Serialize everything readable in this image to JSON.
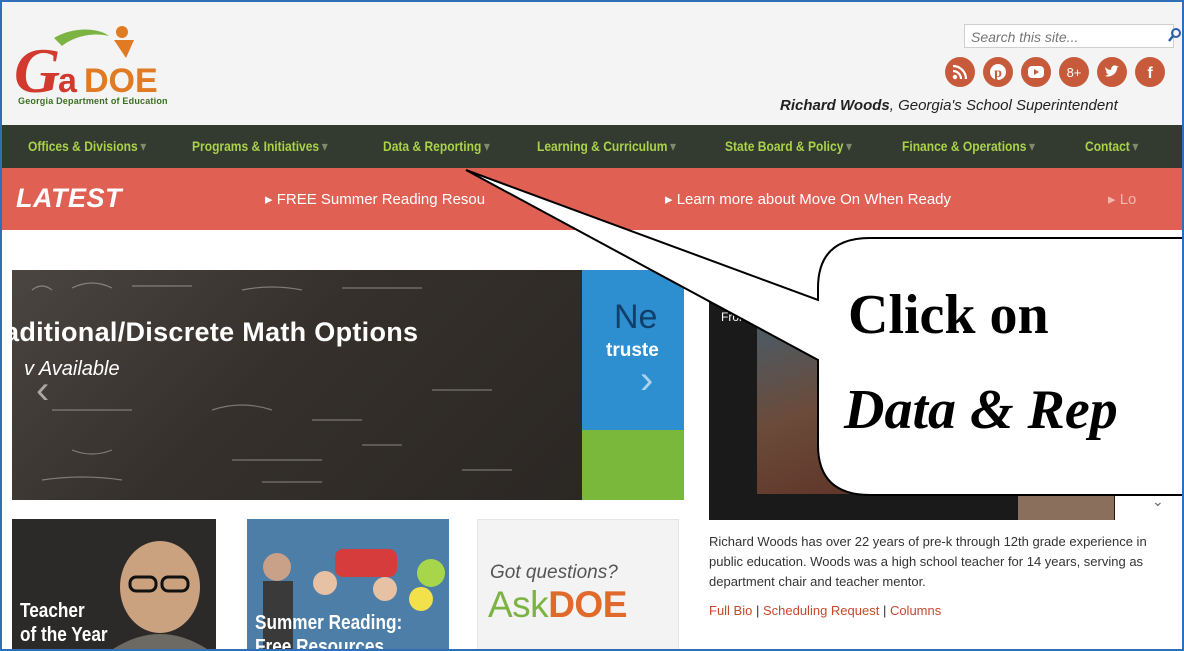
{
  "header": {
    "logo_text": "GaDOE",
    "logo_subtitle": "Georgia Department of Education",
    "search_placeholder": "Search this site...",
    "social_icons": [
      "rss-icon",
      "pinterest-icon",
      "youtube-icon",
      "google-plus-icon",
      "twitter-icon",
      "facebook-icon"
    ],
    "superintendent_name": "Richard Woods",
    "superintendent_title": ", Georgia's School Superintendent"
  },
  "nav": {
    "items": [
      {
        "label": "Offices & Divisions"
      },
      {
        "label": "Programs & Initiatives"
      },
      {
        "label": "Data & Reporting"
      },
      {
        "label": "Learning & Curriculum"
      },
      {
        "label": "State Board & Policy"
      },
      {
        "label": "Finance & Operations"
      },
      {
        "label": "Contact"
      }
    ]
  },
  "latest": {
    "label": "LATEST",
    "items": [
      "▸ FREE Summer Reading Resou",
      "▸ Learn more about Move On When Ready",
      "▸ Lo"
    ]
  },
  "carousel": {
    "title": "aditional/Discrete Math Options",
    "subtitle": "v Available",
    "side_title": "Ne",
    "side_sub": "truste",
    "prev_glyph": "‹",
    "next_glyph": "›"
  },
  "video": {
    "label": "From G",
    "chevron": "⌄"
  },
  "bio": {
    "text": "Richard Woods has over 22 years of pre-k through 12th grade experience in public education. Woods was a high school teacher for 14 years, serving as department chair and teacher mentor.",
    "link_full_bio": "Full Bio",
    "link_scheduling": "Scheduling Request",
    "link_columns": "Columns",
    "separator": " | "
  },
  "tiles": {
    "teacher": "Teacher\nof the Year",
    "summer": "Summer Reading:\nFree Resources",
    "got_questions": "Got questions?",
    "ask": "Ask",
    "doe": "DOE"
  },
  "callout": {
    "line1": "Click on",
    "line2": "Data & Rep"
  },
  "colors": {
    "nav_bg": "#333a2f",
    "nav_text": "#a9d24a",
    "latest_bg": "#e06054",
    "link": "#c6492b"
  }
}
